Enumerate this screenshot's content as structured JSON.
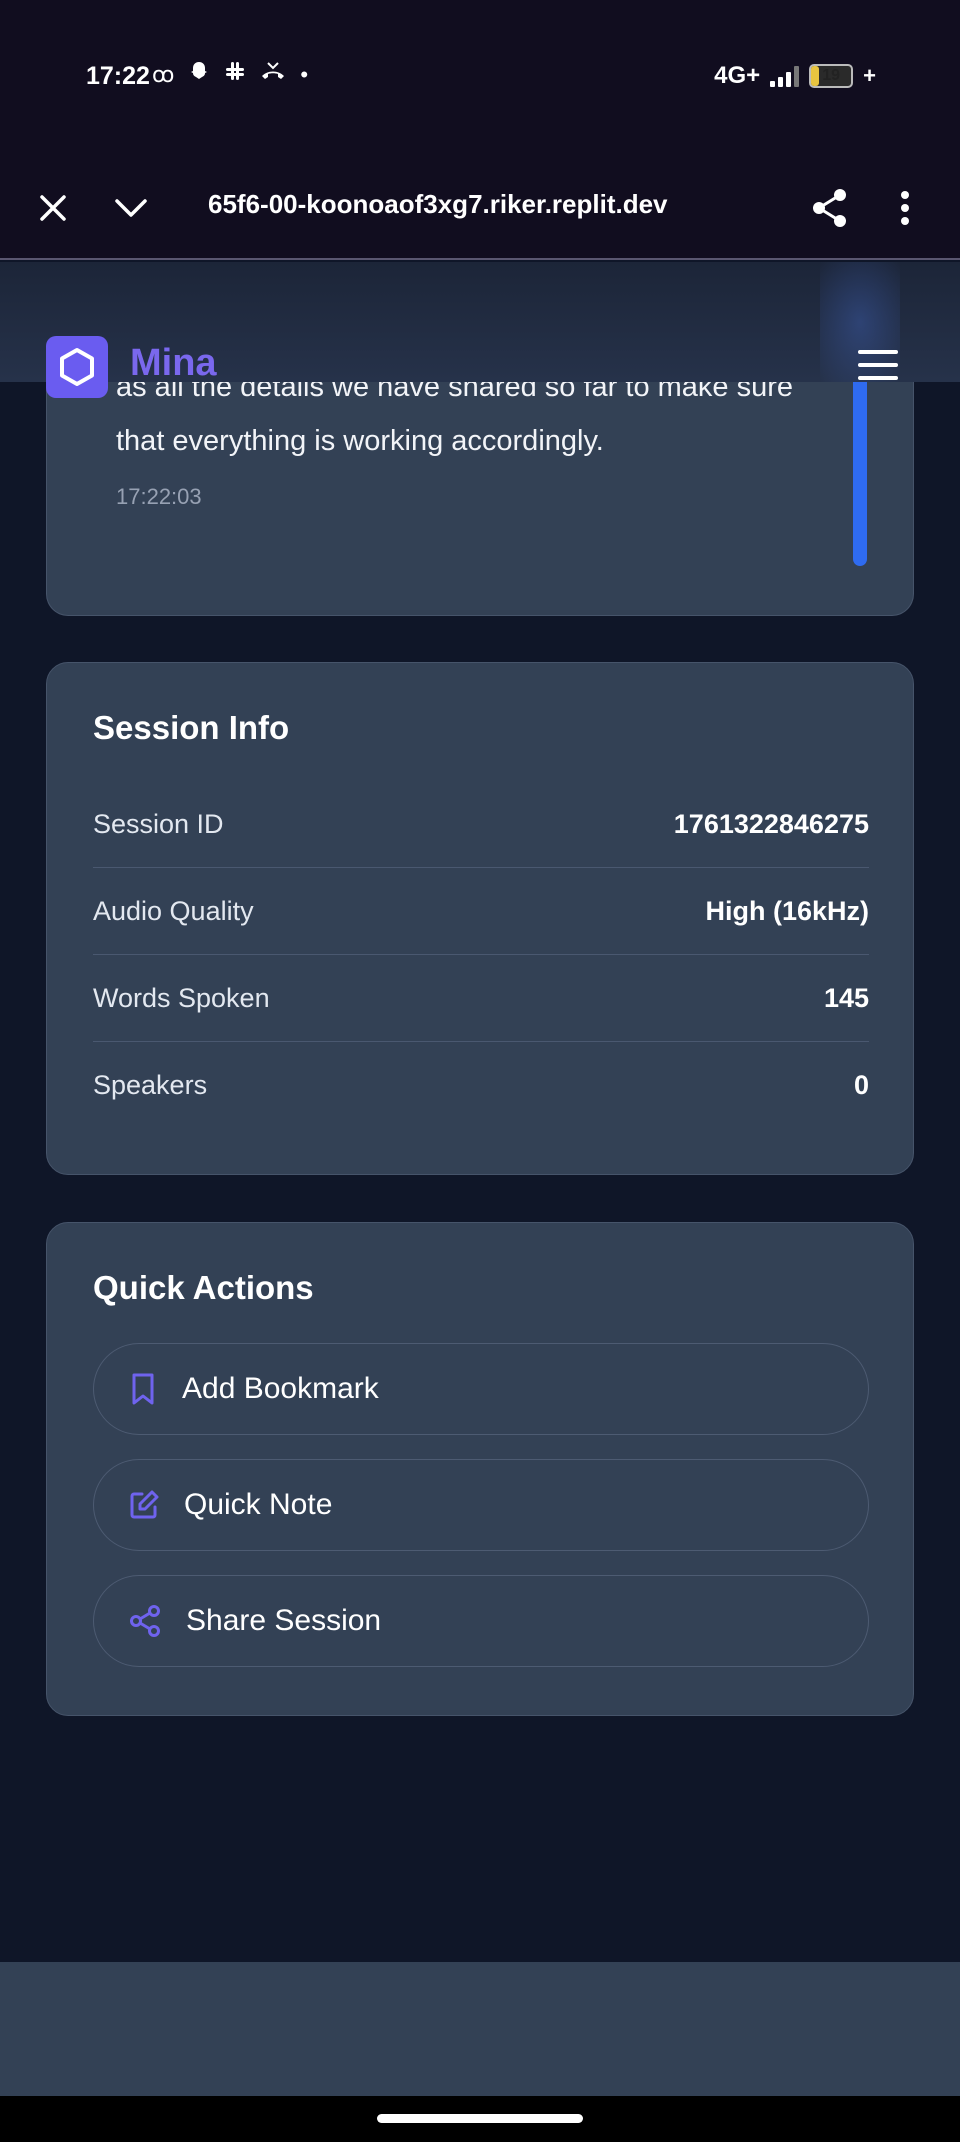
{
  "status_bar": {
    "time": "17:22",
    "left_icons": [
      "voicemail-icon",
      "snapchat-icon",
      "slack-icon",
      "missed-call-icon",
      "dot-icon"
    ],
    "network": "4G+",
    "battery": "19",
    "battery_level_percent": 19,
    "charging": "+"
  },
  "browser": {
    "url": "65f6-00-koonoaof3xg7.riker.replit.dev"
  },
  "app": {
    "brand": "Mina"
  },
  "transcript": {
    "text_line1": "as all the details we have shared so far to make sure",
    "text_line2": "that everything is working accordingly.",
    "timestamp": "17:22:03"
  },
  "session_info": {
    "title": "Session Info",
    "rows": [
      {
        "label": "Session ID",
        "value": "1761322846275"
      },
      {
        "label": "Audio Quality",
        "value": "High (16kHz)"
      },
      {
        "label": "Words Spoken",
        "value": "145"
      },
      {
        "label": "Speakers",
        "value": "0"
      }
    ]
  },
  "quick_actions": {
    "title": "Quick Actions",
    "buttons": [
      {
        "label": "Add Bookmark",
        "icon": "bookmark-icon"
      },
      {
        "label": "Quick Note",
        "icon": "edit-icon"
      },
      {
        "label": "Share Session",
        "icon": "share-icon"
      }
    ]
  },
  "colors": {
    "accent": "#6a5cf0",
    "card": "#334155",
    "background": "#0f1628",
    "scroll_indicator": "#2f6bf0"
  }
}
